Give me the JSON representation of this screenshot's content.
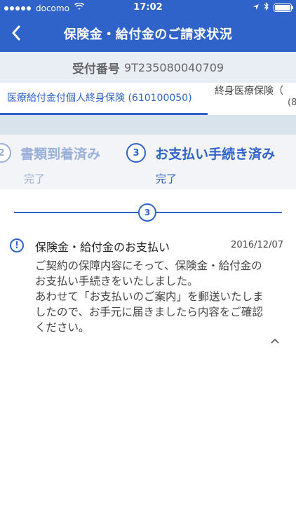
{
  "status_bar": {
    "carrier": "docomo",
    "time": "17:02"
  },
  "header": {
    "title": "保険金・給付金のご請求状況",
    "back_icon": "chevron-left-icon"
  },
  "receipt": {
    "label": "受付番号",
    "number": "9T235080040709"
  },
  "tabs": [
    {
      "label": "医療給付金付個人終身保険 (610100050)",
      "selected": true
    },
    {
      "label": "終身医療保険（",
      "label_line2": "(8"
    }
  ],
  "steps": [
    {
      "number": "2",
      "title": "書類到着済み",
      "status": "完了"
    },
    {
      "number": "3",
      "title": "お支払い手続き済み",
      "status": "完了"
    }
  ],
  "timeline": {
    "step": "3"
  },
  "notice": {
    "icon": "exclamation-icon",
    "title": "保険金・給付金のお支払い",
    "date": "2016/12/07",
    "body_lines": [
      "ご契約の保障内容にそって、保険金・給付金の",
      "お支払い手続きをいたしました。",
      "あわせて「お支払いのご案内」を郵送いたしま",
      "したので、お手元に届きましたら内容をご確認",
      "ください。"
    ],
    "collapse_icon": "chevron-up-icon"
  },
  "colors": {
    "primary": "#2f63c9",
    "done": "#9ab0d8",
    "receipt_bg": "#e9eef5",
    "steps_bg": "#f2f4f7"
  }
}
